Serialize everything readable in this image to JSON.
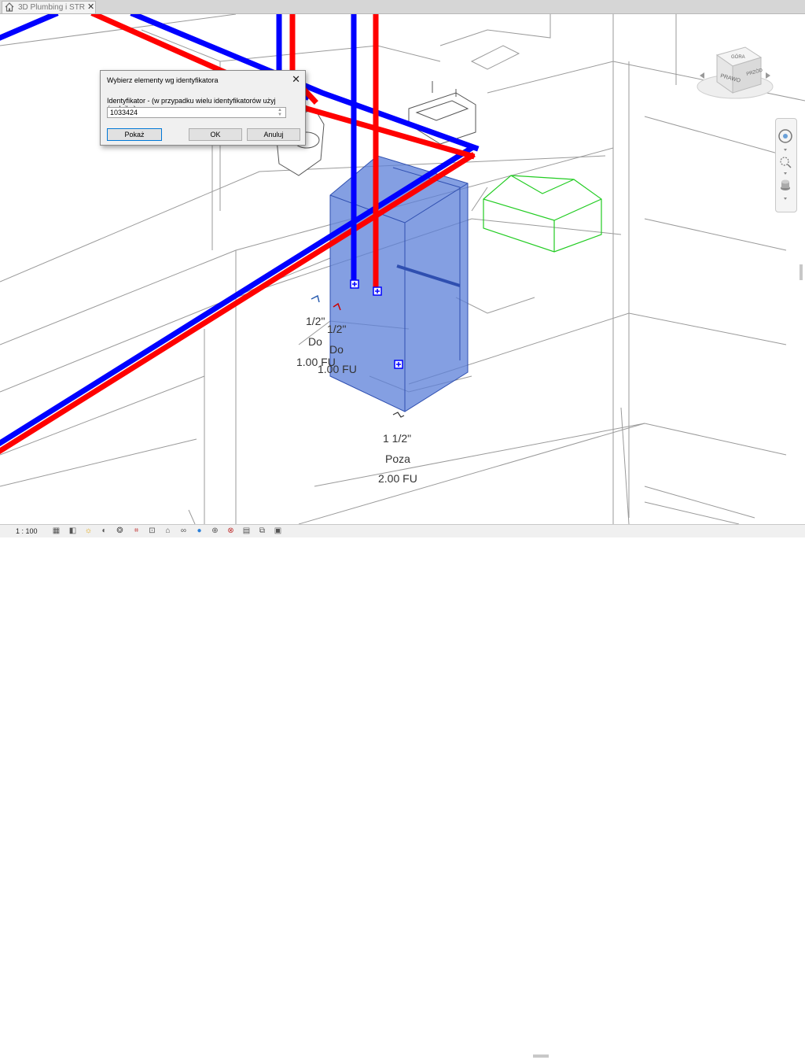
{
  "tab": {
    "title": "3D Plumbing i STR",
    "close": "✕"
  },
  "dialog": {
    "title": "Wybierz elementy wg identyfikatora",
    "close": "✕",
    "label": "Identyfikator - (w przypadku wielu identyfikatorów użyj średnika):",
    "value": "1033424",
    "buttons": {
      "show": "Pokaż",
      "ok": "OK",
      "cancel": "Anuluj"
    }
  },
  "tags": {
    "tag1": {
      "size": "1/2\"",
      "direction": "Do",
      "fu": "1.00 FU"
    },
    "tag2": {
      "size": "1/2\"",
      "direction": "Do",
      "fu": "1.00 FU"
    },
    "tag3": {
      "size": "1 1/2\"",
      "direction": "Poza",
      "fu": "2.00 FU"
    }
  },
  "viewcube": {
    "face_right": "PRAWO",
    "face_front": "PRZÓD",
    "face_top": "GÓRA"
  },
  "status": {
    "scale": "1 : 100"
  },
  "colors": {
    "hot": "#ff0000",
    "cold": "#0000ff",
    "selection": "#5b7fd8",
    "fixture": "#22cc22"
  },
  "icons": [
    "visual-style-icon",
    "sun-icon",
    "shadows-icon",
    "crop-icon",
    "show-crop-icon",
    "hide-isolate-icon",
    "reveal-icon",
    "lock-icon",
    "temporary-icon",
    "analysis-icon",
    "highlight-icon",
    "properties-icon",
    "constraints-icon",
    "worksharing-icon",
    "display-icon",
    "hidden-icon"
  ]
}
